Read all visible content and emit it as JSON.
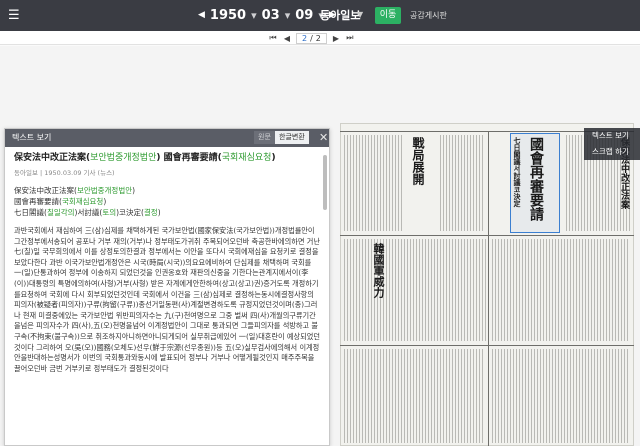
{
  "topbar": {
    "back_icon": "hamburger-icon",
    "year": "1950",
    "month": "03",
    "day": "09",
    "paper": "동아일보",
    "move_label": "이동",
    "notice_label": "공감게시판"
  },
  "pager": {
    "current": "2",
    "total": "2"
  },
  "panel": {
    "title": "텍스트 보기",
    "tab_original": "원문",
    "tab_hangul": "한글변환",
    "headline_parts": [
      "保安法中改正法案(",
      "보안법중개정법안",
      ") 國會再審要請(",
      "국회재심요청",
      ")"
    ],
    "meta": "동아일보 | 1950.03.09 기사 (뉴스)",
    "sub_lines": [
      [
        "保安法中改正法案(",
        "보안법중개정법안",
        ")"
      ],
      [
        "國會再審要請(",
        "국회재심요청",
        ")"
      ],
      [
        "七日閣議(",
        "칠일각의",
        ")서討議(",
        "토의",
        ")코決定(",
        "결정",
        ")"
      ]
    ],
    "body": "과반국회에서 재심하여 三(삼)심제를 채택하게된 국가보안법(國家保安法(국가보안법))개정법률안이 그간정부에서송되어 공포나 거부 재의(거부)나 정부태도가귀취 주목되어오던바 축공한바에의하면 거난七(칠)일 국무회의에서 이를 상정토의한결과 정부에서는 이안을 또다시 국회에재심을 요청키로 결정을보았다한다 과반 이국가보안법개정안은 시국(時局(시국))의요요에비하여 단심제를 채택하며 국회를 一(일)단통과하여 정부에 이송하지 되었던것을 인권옹호와 재판의신중을 기한다는관계지에서이(李(이))대통령의 특명에의하여(사형)거부(사형) 받은 자계에게안한하여(상고(상고)권)증거도록 개정하기를요청하여 국회에 다시 회부되었던것인데 국회에서 이건을 三(삼)심제로 결정하는동시에결정사항의 피의자(被疑者(피의자))구류(拘留(구류))종선거일동편(사)계절변경하도록 규정지었던것이며(종)그러나 현재 미결중에있는 국가보안법 위반피의자수는 九(구)천여명으로 그중 벌써 四(사)개월의구류기간을넘은 피의자수가 四(사),五(오)천명을넘어 이계정법안이 그대로 통과되면 그들피의자를 석방하고 불구속(不拘束(불구속))으로 취조하지아니하면아니되게되어 실무취급에있어 一(일)대혼란이 예상되었던것이다 그리하여 오(吳(오))國務(오체도)선우(鮮于宗源(선우종원))등 五(오)실무검사에의해서 이계정안을반대하는성명서가 이번의 국회통과와동시에 발표되어 정부나 거부나 어떻게될것인지 매주주목을끌어오던바 금번 거부키로 정부태도가 결정된것이다"
  },
  "scan": {
    "headline_1": "保安法中改正法案",
    "headline_2": "國會再審要請",
    "headline_3": "七日閣議서討議코決定",
    "headline_4": "戰局展開",
    "headline_5": "韓國軍威力",
    "menu_items": [
      "텍스트 보기",
      "스크랩 하기"
    ]
  }
}
